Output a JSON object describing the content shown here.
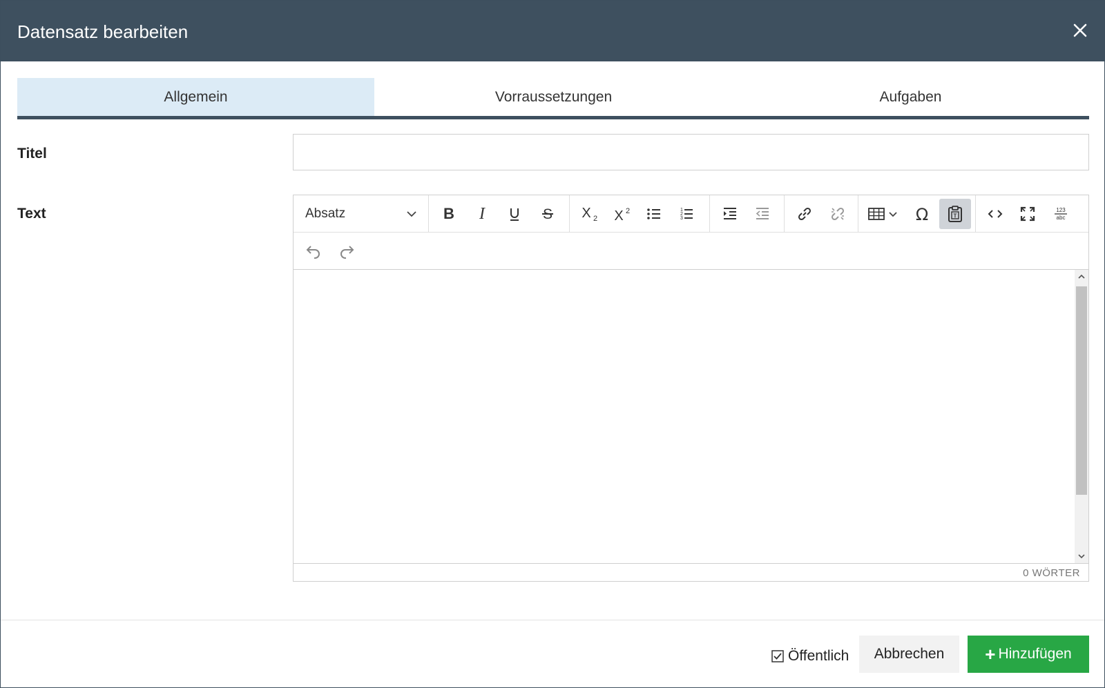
{
  "dialog": {
    "title": "Datensatz bearbeiten",
    "close_icon": "close-icon"
  },
  "tabs": [
    {
      "label": "Allgemein",
      "active": true
    },
    {
      "label": "Vorraussetzungen",
      "active": false
    },
    {
      "label": "Aufgaben",
      "active": false
    }
  ],
  "form": {
    "title_label": "Titel",
    "title_value": "",
    "text_label": "Text"
  },
  "editor": {
    "block_format": "Absatz",
    "toolbar_icons": [
      "bold-icon",
      "italic-icon",
      "underline-icon",
      "strikethrough-icon",
      "subscript-icon",
      "superscript-icon",
      "bullet-list-icon",
      "numbered-list-icon",
      "indent-icon",
      "outdent-icon",
      "link-icon",
      "unlink-icon",
      "table-icon",
      "special-char-icon",
      "paste-as-text-icon",
      "source-code-icon",
      "fullscreen-icon",
      "spellcheck-icon",
      "undo-icon",
      "redo-icon"
    ],
    "word_count": "0 WÖRTER"
  },
  "footer": {
    "public_label": "Öffentlich",
    "public_checked": true,
    "cancel_label": "Abbrechen",
    "add_label": "Hinzufügen"
  },
  "colors": {
    "header_bg": "#3e505f",
    "active_tab_bg": "#dcebf6",
    "add_button": "#28a745"
  }
}
